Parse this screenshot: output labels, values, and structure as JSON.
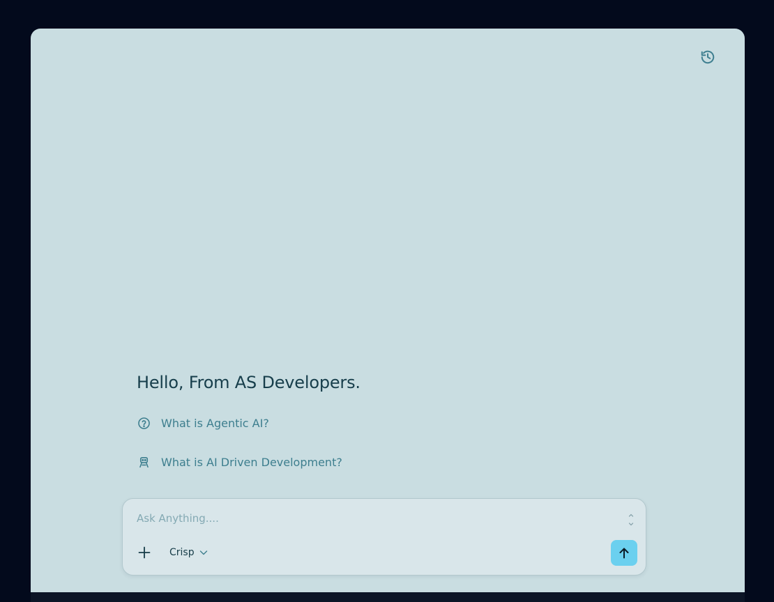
{
  "header": {
    "history_icon": "history-icon"
  },
  "greeting": "Hello, From AS Developers.",
  "suggestions": [
    {
      "icon": "question-circle-icon",
      "label": "What is Agentic AI?"
    },
    {
      "icon": "robot-icon",
      "label": "What is AI Driven Development?"
    }
  ],
  "composer": {
    "placeholder": "Ask Anything....",
    "value": "",
    "add_icon": "plus-icon",
    "model_label": "Crisp",
    "model_chevron_icon": "chevron-down-icon",
    "send_icon": "arrow-up-icon"
  },
  "colors": {
    "page_background": "#030a1c",
    "panel_background": "#c9dde1",
    "composer_background": "#d9e6ea",
    "send_button": "#6bd0ef",
    "heading_text": "#173e4b",
    "suggestion_text": "#3d7e8e"
  }
}
